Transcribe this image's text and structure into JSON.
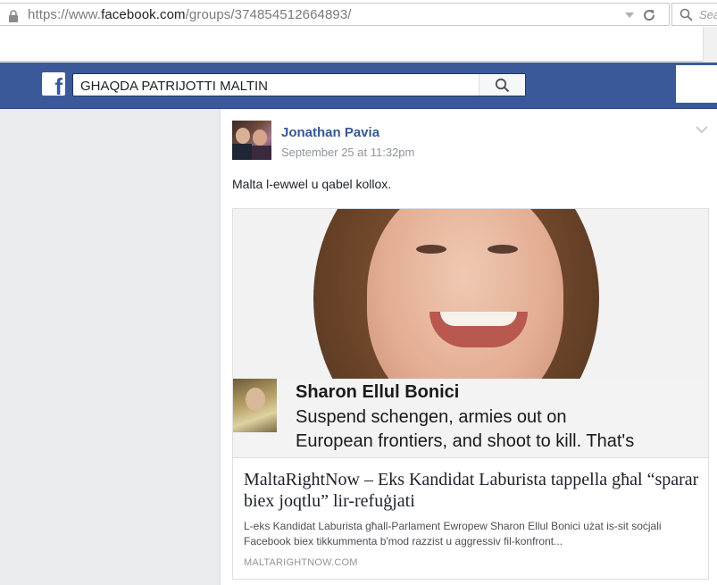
{
  "browser": {
    "url_prefix": "https://www.",
    "url_host": "facebook.com",
    "url_path": "/groups/374854512664893/",
    "search_placeholder": "Sea"
  },
  "fb_header": {
    "search_value": "GHAQDA PATRIJOTTI MALTIN",
    "brand_color": "#3b5998"
  },
  "post": {
    "author": "Jonathan Pavia",
    "timestamp": "September 25 at 11:32pm",
    "text": "Malta l-ewwel u qabel kollox.",
    "link": {
      "image_quote_name": "Sharon Ellul Bonici",
      "image_quote_line1": "Suspend schengen, armies out on",
      "image_quote_line2": "European frontiers, and shoot to kill. That's",
      "title": "MaltaRightNow – Eks Kandidat Laburista tappella għal “sparar biex joqtlu” lir-refuġjati",
      "description": "L-eks Kandidat Laburista għall-Parlament Ewropew Sharon Ellul Bonici użat is-sit soċjali Facebook biex tikkummenta b'mod razzist u aggressiv fil-konfront...",
      "domain": "MALTARIGHTNOW.COM"
    }
  }
}
